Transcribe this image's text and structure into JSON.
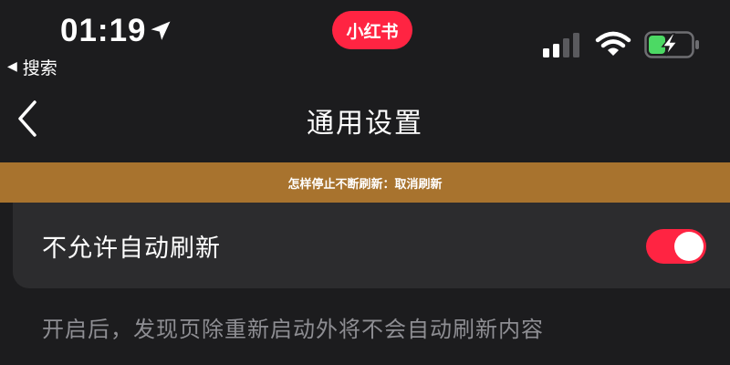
{
  "status_bar": {
    "time": "01:19",
    "app_badge": "小红书",
    "icons": [
      "location-arrow-icon",
      "signal-icon",
      "wifi-icon",
      "battery-charging-icon"
    ],
    "signal_bars_active": 2,
    "signal_bars_total": 4,
    "battery_level": 0.4
  },
  "back_to_app": {
    "arrow": "◀",
    "label": "搜索"
  },
  "nav": {
    "title": "通用设置",
    "back_icon": "chevron-left-icon"
  },
  "banner": {
    "text": "怎样停止不断刷新：取消刷新"
  },
  "setting": {
    "label": "不允许自动刷新",
    "enabled": true,
    "description": "开启后，发现页除重新启动外将不会自动刷新内容"
  },
  "colors": {
    "background": "#1c1c1e",
    "card": "#2c2c2e",
    "accent": "#ff2442",
    "banner": "#a8732e",
    "battery": "#4cd964",
    "secondary_text": "#8e8e93"
  }
}
